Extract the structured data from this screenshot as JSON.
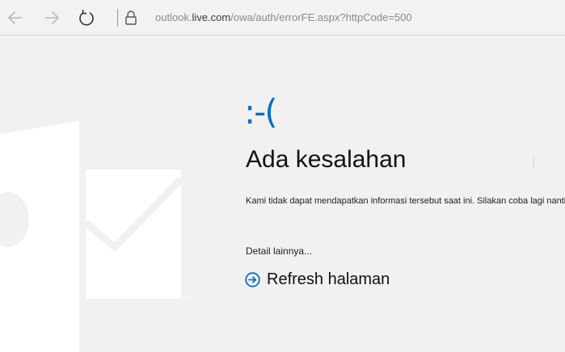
{
  "browser": {
    "address_prefix": "outlook.",
    "address_domain": "live.com",
    "address_path": "/owa/auth/errorFE.aspx?httpCode=500",
    "icons": {
      "back": "arrow-left-icon",
      "forward": "arrow-right-icon",
      "refresh": "refresh-icon",
      "lock": "lock-icon"
    }
  },
  "error": {
    "face": ":-(",
    "title": "Ada kesalahan",
    "message": "Kami tidak dapat mendapatkan informasi tersebut saat ini. Silakan coba lagi nanti.",
    "more_details": "Detail lainnya...",
    "refresh_label": "Refresh halaman"
  },
  "colors": {
    "accent": "#0a6fc4",
    "background": "#f1f1f1",
    "logo_watermark": "#ffffff"
  }
}
